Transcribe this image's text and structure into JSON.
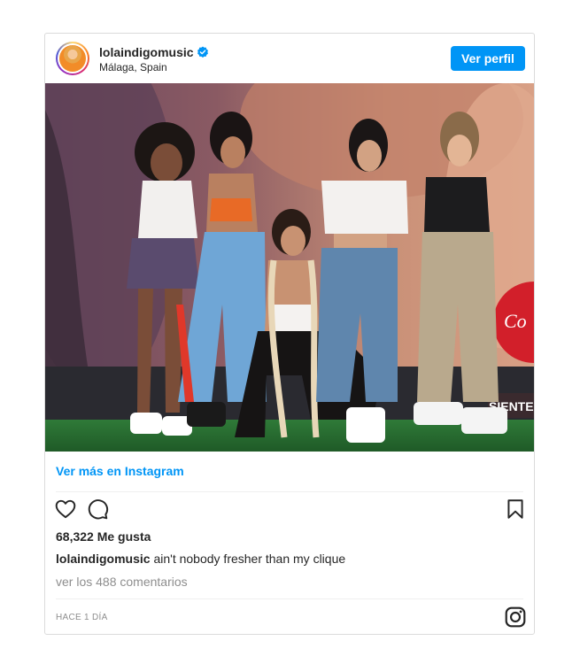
{
  "post": {
    "username": "lolaindigomusic",
    "location": "Málaga, Spain",
    "verified": true,
    "profile_button": "Ver perfil",
    "more_link": "Ver más en Instagram",
    "likes": "68,322 Me gusta",
    "caption_user": "lolaindigomusic",
    "caption_text": "ain't nobody fresher than my clique",
    "comments_link": "ver los 488 comentarios",
    "timestamp": "HACE 1 DÍA",
    "photo_text": "SIENTE"
  },
  "colors": {
    "accent": "#0095f6",
    "text": "#262626",
    "muted": "#8e8e8e",
    "border": "#dbdbdb"
  },
  "icons": {
    "verified": "verified-badge-icon",
    "like": "heart-icon",
    "comment": "comment-icon",
    "save": "bookmark-icon",
    "brand": "instagram-icon"
  }
}
